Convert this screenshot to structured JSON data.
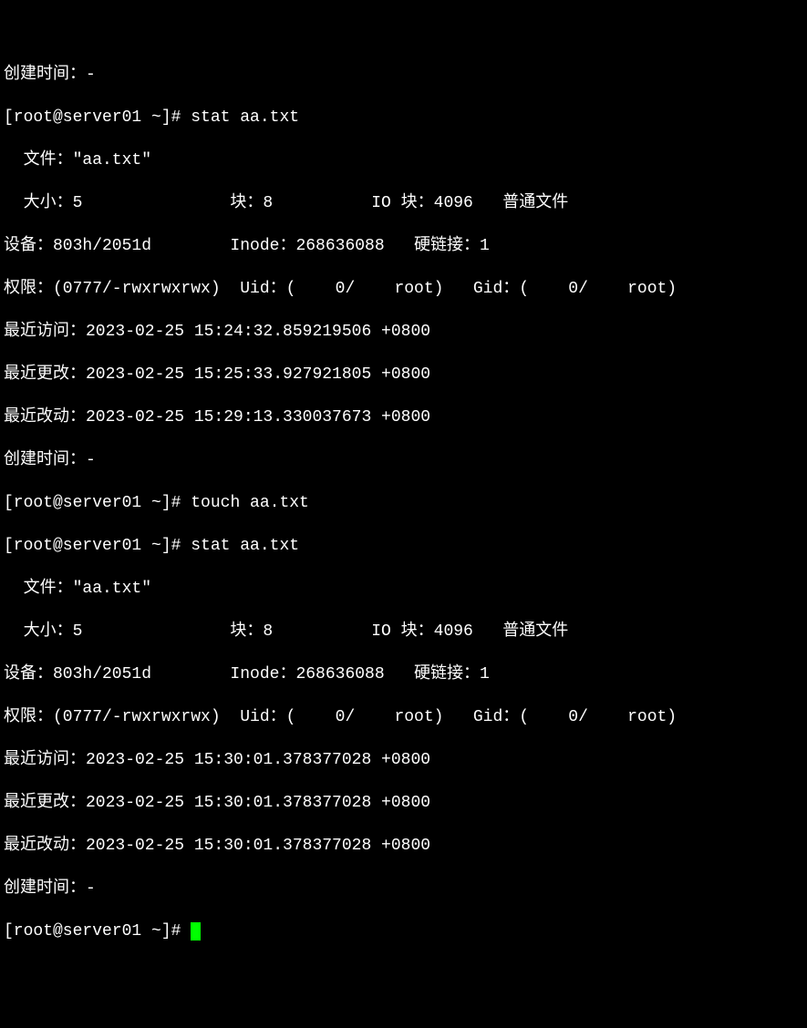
{
  "lines": {
    "l00": "创建时间：-",
    "l01": "[root@server01 ~]# stat aa.txt",
    "l02": "  文件：\"aa.txt\"",
    "l03": "  大小：5               块：8          IO 块：4096   普通文件",
    "l04": "设备：803h/2051d        Inode：268636088   硬链接：1",
    "l05": "权限：(0777/-rwxrwxrwx)  Uid：(    0/    root)   Gid：(    0/    root)",
    "l06": "最近访问：2023-02-25 15:24:32.859219506 +0800",
    "l07": "最近更改：2023-02-25 15:25:33.927921805 +0800",
    "l08": "最近改动：2023-02-25 15:29:13.330037673 +0800",
    "l09": "创建时间：-",
    "l10": "[root@server01 ~]# touch aa.txt",
    "l11": "[root@server01 ~]# stat aa.txt",
    "l12": "  文件：\"aa.txt\"",
    "l13": "  大小：5               块：8          IO 块：4096   普通文件",
    "l14": "设备：803h/2051d        Inode：268636088   硬链接：1",
    "l15": "权限：(0777/-rwxrwxrwx)  Uid：(    0/    root)   Gid：(    0/    root)",
    "l16": "最近访问：2023-02-25 15:30:01.378377028 +0800",
    "l17": "最近更改：2023-02-25 15:30:01.378377028 +0800",
    "l18": "最近改动：2023-02-25 15:30:01.378377028 +0800",
    "l19": "创建时间：-",
    "l20": "[root@server01 ~]# "
  }
}
